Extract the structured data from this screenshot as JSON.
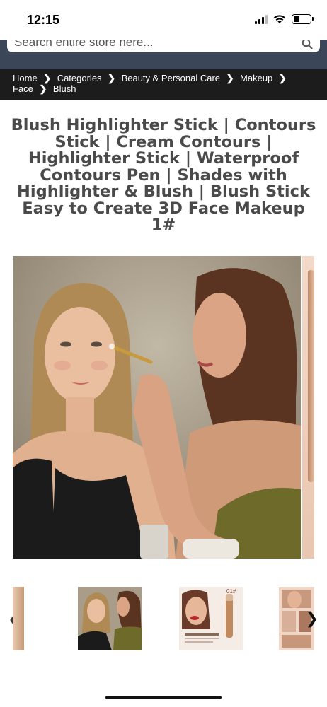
{
  "status_bar": {
    "time": "12:15",
    "icons": [
      "signal-icon",
      "wifi-icon",
      "battery-icon"
    ],
    "battery_level": 0.35
  },
  "search": {
    "placeholder": "Search entire store here..."
  },
  "breadcrumb": {
    "items": [
      "Home",
      "Categories",
      "Beauty & Personal Care",
      "Makeup",
      "Face",
      "Blush"
    ]
  },
  "product": {
    "title": "Blush Highlighter Stick | Contours Stick | Cream Contours | Highlighter Stick | Waterproof Contours Pen | Shades with Highlighter & Blush | Blush Stick Easy to Create 3D Face Makeup 1#"
  },
  "thumbnail_badge": "01#",
  "colors": {
    "header_band": "#3b4758",
    "breadcrumb_bg": "#1c1c1c",
    "title_text": "#4a4a4a"
  }
}
